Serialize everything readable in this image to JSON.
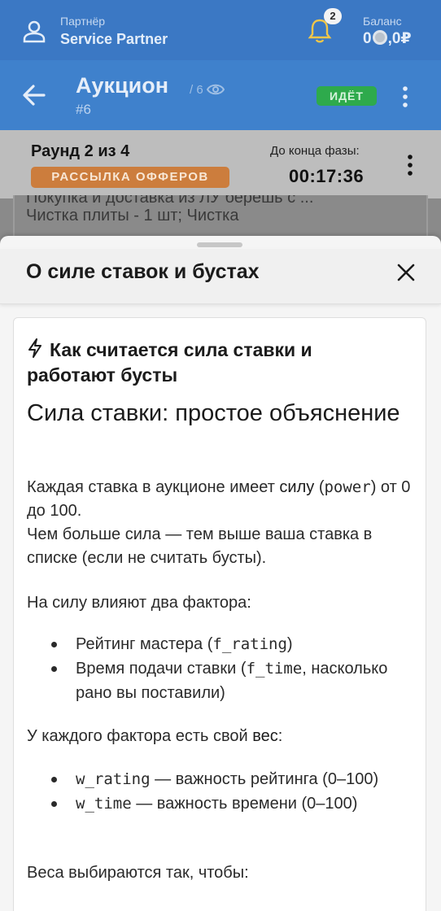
{
  "topbar": {
    "partner_label": "Партнёр",
    "partner_name": "Service Partner",
    "notifications_count": "2",
    "balance_label": "Баланс",
    "balance_before": "0",
    "balance_after": ",0₽"
  },
  "auction": {
    "title": "Аукцион",
    "viewers": "/ 6",
    "id": "#6",
    "status": "ИДЁТ"
  },
  "round": {
    "title": "Раунд 2 из 4",
    "phase": "РАССЫЛКА ОФФЕРОВ",
    "timer_label": "До конца фазы:",
    "timer_value": "00:17:36"
  },
  "background_card": {
    "line1": "Покупка и доставка из ЛУ берёшь с ...",
    "line2": "Чистка плиты - 1 шт; Чистка"
  },
  "sheet": {
    "title": "О силе ставок и бустах",
    "heading": "Как считается сила ставки и работают бусты",
    "subheading": "Сила ставки: простое объяснение",
    "p1_a": "Каждая ставка в аукционе имеет ",
    "p1_b": "силу",
    "p1_c": " (",
    "p1_code": "power",
    "p1_d": ") от 0 до 100.",
    "p1_line2": "Чем больше сила — тем выше ваша ставка в списке (если не считать бусты).",
    "p2": "На силу влияют два фактора:",
    "list1": [
      {
        "text": "Рейтинг мастера (",
        "code": "f_rating",
        "tail": ")"
      },
      {
        "text": "Время подачи ставки (",
        "code": "f_time",
        "tail": ", насколько рано вы поставили)"
      }
    ],
    "p3_a": "У каждого фактора есть свой ",
    "p3_b": "вес",
    "p3_c": ":",
    "list2": [
      {
        "code": "w_rating",
        "text": " — важность рейтинга (0–100)"
      },
      {
        "code": "w_time",
        "text": " — важность времени (0–100)"
      }
    ],
    "p4": "Веса выбираются так, чтобы:"
  },
  "colors": {
    "topbar_bg": "#3b78c4",
    "auction_bg": "#3f81cc",
    "status_green": "#2eaa4c",
    "phase_orange": "#cc7d3d"
  }
}
